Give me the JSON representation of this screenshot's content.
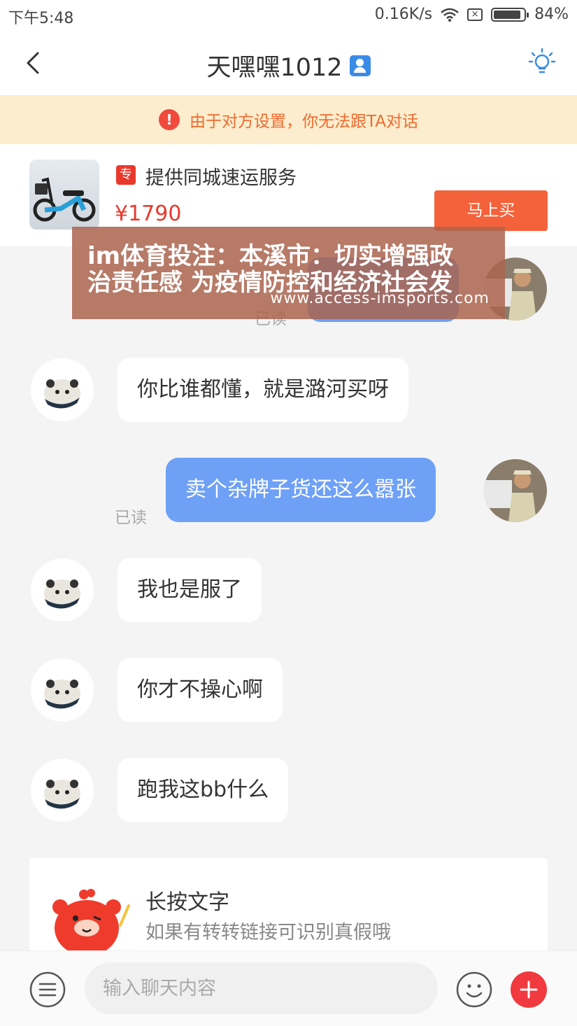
{
  "status_bar": {
    "time": "下午5:48",
    "speed": "0.16K/s",
    "battery": "84%"
  },
  "header": {
    "title": "天嘿嘿1012"
  },
  "notice": {
    "text": "由于对方设置，你无法跟TA对话"
  },
  "product": {
    "tag": "专",
    "name": "提供同城速运服务",
    "price": "¥1790",
    "buy_label": "马上买"
  },
  "watermark": {
    "line1": "im体育投注：本溪市：切实增强政",
    "line2": "治责任感 为疫情防控和经济社会发",
    "url": "www.access-imsports.com"
  },
  "messages": [
    {
      "side": "me",
      "text": "",
      "read": "已读"
    },
    {
      "side": "other",
      "text": "你比谁都懂，就是潞河买呀"
    },
    {
      "side": "me",
      "text": "卖个杂牌子货还这么嚣张",
      "read": "已读"
    },
    {
      "side": "other",
      "text": "我也是服了"
    },
    {
      "side": "other",
      "text": "你才不操心啊"
    },
    {
      "side": "other",
      "text": "跑我这bb什么"
    }
  ],
  "tip": {
    "title": "长按文字",
    "subtitle": "如果有转转链接可识别真假哦"
  },
  "input": {
    "placeholder": "输入聊天内容"
  },
  "colors": {
    "accent": "#f4623b",
    "my_bubble": "#6ea0f6",
    "notice_bg": "#fbedcd",
    "notice_text": "#f06a30"
  }
}
